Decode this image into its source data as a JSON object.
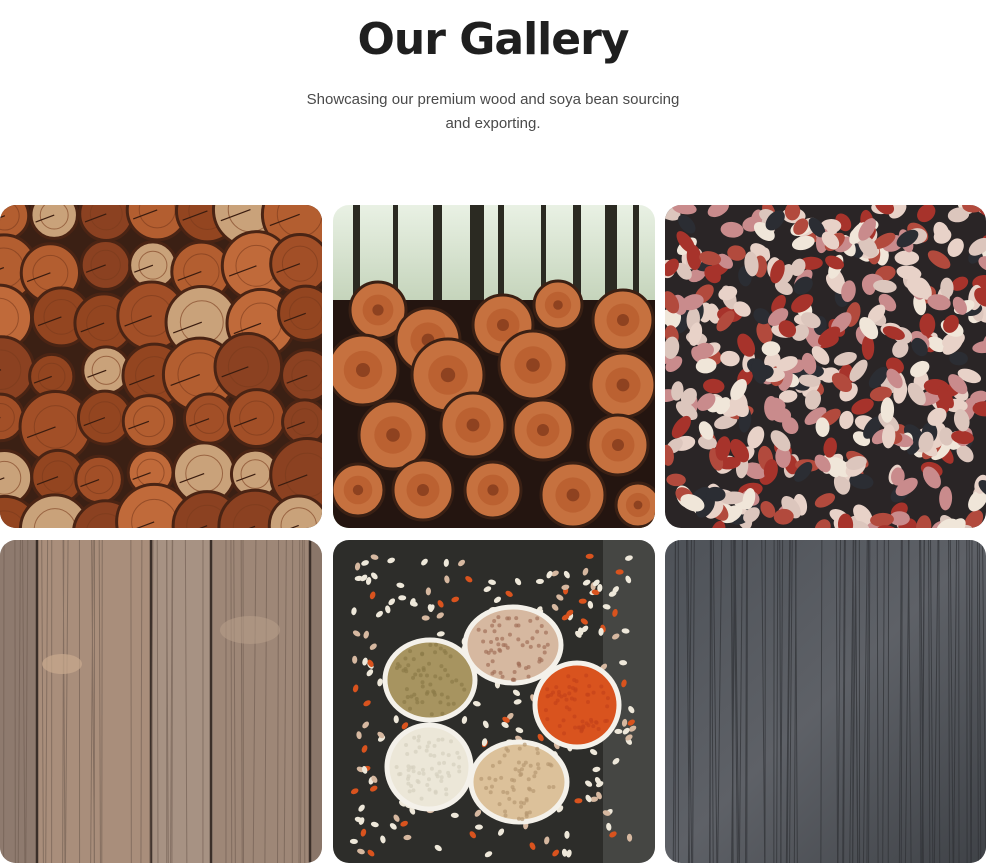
{
  "header": {
    "title": "Our Gallery",
    "subtitle": "Showcasing our premium wood and soya bean sourcing and exporting."
  },
  "gallery": {
    "images": [
      {
        "subject": "stacked-log-ends"
      },
      {
        "subject": "cut-logs-in-forest"
      },
      {
        "subject": "mixed-beans"
      },
      {
        "subject": "weathered-wood-planks"
      },
      {
        "subject": "legumes-in-bowls"
      },
      {
        "subject": "dark-wood-texture"
      }
    ]
  },
  "colors": {
    "title": "#1f1f1f",
    "subtitle": "#4a4a4a",
    "wood": "#a8552c",
    "bean_red": "#a7332b",
    "lentil_orange": "#e0541c"
  }
}
